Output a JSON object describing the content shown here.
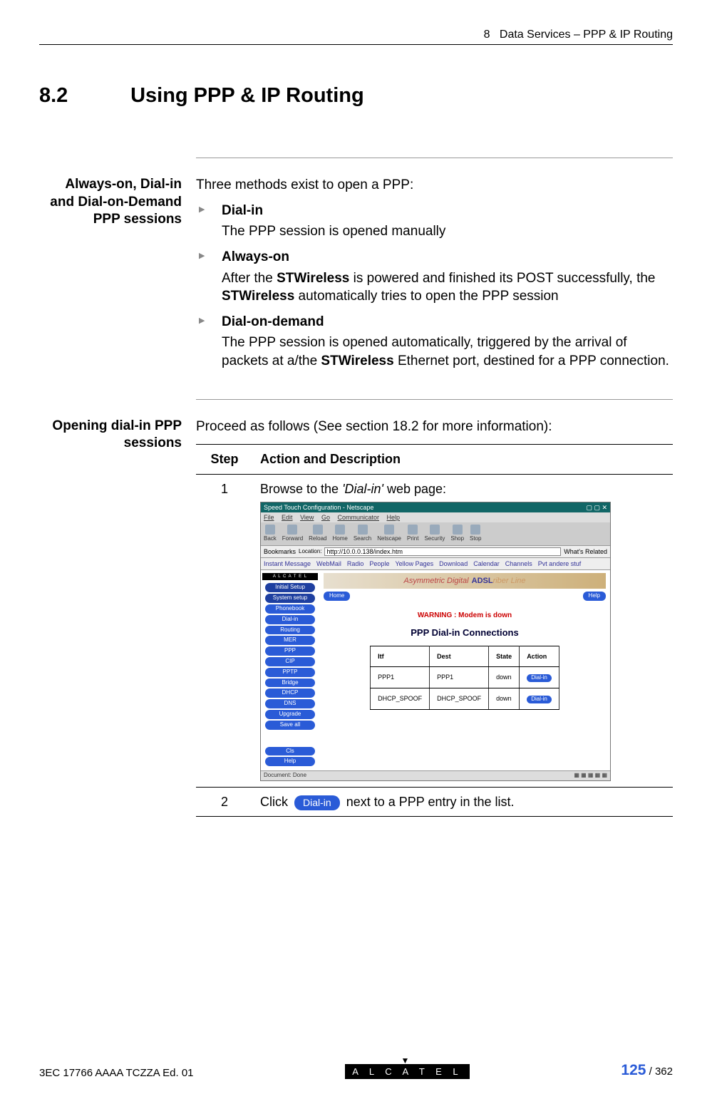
{
  "header": {
    "chapter_num": "8",
    "chapter_title": "Data Services – PPP & IP Routing"
  },
  "section": {
    "number": "8.2",
    "title": "Using PPP & IP Routing"
  },
  "block1": {
    "side_heading": "Always-on, Dial-in and Dial-on-Demand PPP sessions",
    "intro": "Three methods exist to open a PPP:",
    "items": [
      {
        "term": "Dial-in",
        "desc_pre": "The PPP session is opened manually",
        "desc_bold1": "",
        "desc_mid": "",
        "desc_bold2": "",
        "desc_post": ""
      },
      {
        "term": "Always-on",
        "desc_pre": "After the ",
        "desc_bold1": "STWireless",
        "desc_mid": " is powered and finished its POST successfully, the ",
        "desc_bold2": "STWireless",
        "desc_post": " automatically tries to open the PPP session"
      },
      {
        "term": "Dial-on-demand",
        "desc_pre": "The PPP session is opened automatically, triggered by the arrival of packets at a/the ",
        "desc_bold1": "STWireless",
        "desc_mid": " Ethernet port, destined for a PPP connection.",
        "desc_bold2": "",
        "desc_post": ""
      }
    ]
  },
  "block2": {
    "side_heading": "Opening dial-in PPP sessions",
    "intro": "Proceed as follows (See section 18.2 for more information):",
    "table": {
      "head_step": "Step",
      "head_action": "Action and Description",
      "rows": [
        {
          "step": "1",
          "text_pre": "Browse to the ",
          "text_italic": "'Dial-in'",
          "text_post": " web page:"
        },
        {
          "step": "2",
          "text_pre": "Click ",
          "pill": "Dial-in",
          "text_post": "  next to a PPP entry in the list."
        }
      ]
    }
  },
  "browser_mock": {
    "title": "Speed Touch Configuration - Netscape",
    "menu": [
      "File",
      "Edit",
      "View",
      "Go",
      "Communicator",
      "Help"
    ],
    "toolbar": [
      "Back",
      "Forward",
      "Reload",
      "Home",
      "Search",
      "Netscape",
      "Print",
      "Security",
      "Shop",
      "Stop"
    ],
    "loc_label": "Bookmarks",
    "loc_url": "http://10.0.0.138/index.htm",
    "loc_right": "What's Related",
    "links": [
      "Instant Message",
      "WebMail",
      "Radio",
      "People",
      "Yellow Pages",
      "Download",
      "Calendar",
      "Channels",
      "Pvt andere stuf"
    ],
    "side_logo": "A L C A T E L",
    "side_items": [
      "Initial Setup",
      "System setup",
      "Phonebook",
      "Dial-in",
      "Routing",
      "MER",
      "PPP",
      "CIP",
      "PPTP",
      "Bridge",
      "DHCP",
      "DNS",
      "Upgrade",
      "Save all",
      "",
      "Cls",
      "Help"
    ],
    "banner_left": "Asymmetric Digital",
    "banner_right": "ADSL",
    "banner_tail": "riber Line",
    "home_btn": "Home",
    "help_btn": "Help",
    "warning": "WARNING : Modem is down",
    "heading": "PPP Dial-in Connections",
    "table_head": [
      "Itf",
      "Dest",
      "State",
      "Action"
    ],
    "table_rows": [
      [
        "PPP1",
        "PPP1",
        "down",
        "Dial-in"
      ],
      [
        "DHCP_SPOOF",
        "DHCP_SPOOF",
        "down",
        "Dial-in"
      ]
    ],
    "status": "Document: Done"
  },
  "footer": {
    "left": "3EC 17766 AAAA TCZZA Ed. 01",
    "logo": "A L C A T E L",
    "page_current": "125",
    "page_sep": " / ",
    "page_total": "362"
  }
}
